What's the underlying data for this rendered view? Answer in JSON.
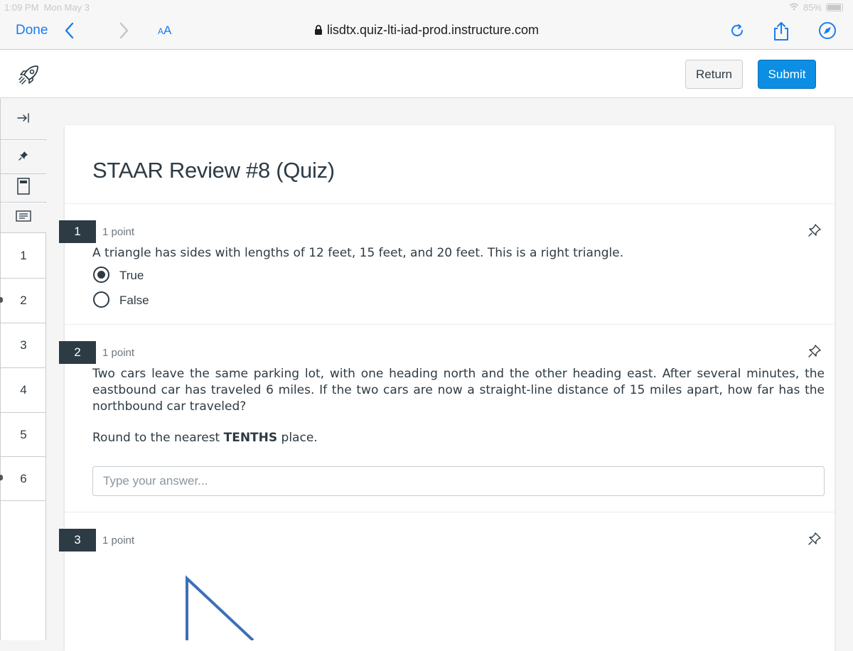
{
  "statusbar": {
    "time": "1:09 PM",
    "date": "Mon May 3",
    "battery": "85%"
  },
  "browser": {
    "done_label": "Done",
    "text_size_label_small": "A",
    "text_size_label_large": "A",
    "url": "lisdtx.quiz-lti-iad-prod.instructure.com"
  },
  "header": {
    "return_label": "Return",
    "submit_label": "Submit"
  },
  "sidebar": {
    "question_numbers": [
      "1",
      "2",
      "3",
      "4",
      "5",
      "6"
    ]
  },
  "quiz": {
    "title": "STAAR Review #8 (Quiz)",
    "questions": [
      {
        "number": "1",
        "points": "1 point",
        "text": "A triangle has sides with lengths of 12 feet, 15 feet, and 20 feet. This is a right triangle.",
        "options": [
          {
            "label": "True",
            "selected": true
          },
          {
            "label": "False",
            "selected": false
          }
        ]
      },
      {
        "number": "2",
        "points": "1 point",
        "text": "Two cars leave the same parking lot, with one heading north and the other heading east. After several minutes, the eastbound car has traveled 6 miles. If the two cars are now a straight-line distance of 15 miles apart, how far has the northbound car traveled?",
        "round_prefix": "Round to the nearest ",
        "round_bold": "TENTHS",
        "round_suffix": " place.",
        "answer_value": "",
        "answer_placeholder": "Type your answer..."
      },
      {
        "number": "3",
        "points": "1 point"
      }
    ]
  },
  "colors": {
    "accent": "#0b8ee3",
    "ios_blue": "#1a7cf0",
    "dark": "#2d3b45"
  }
}
